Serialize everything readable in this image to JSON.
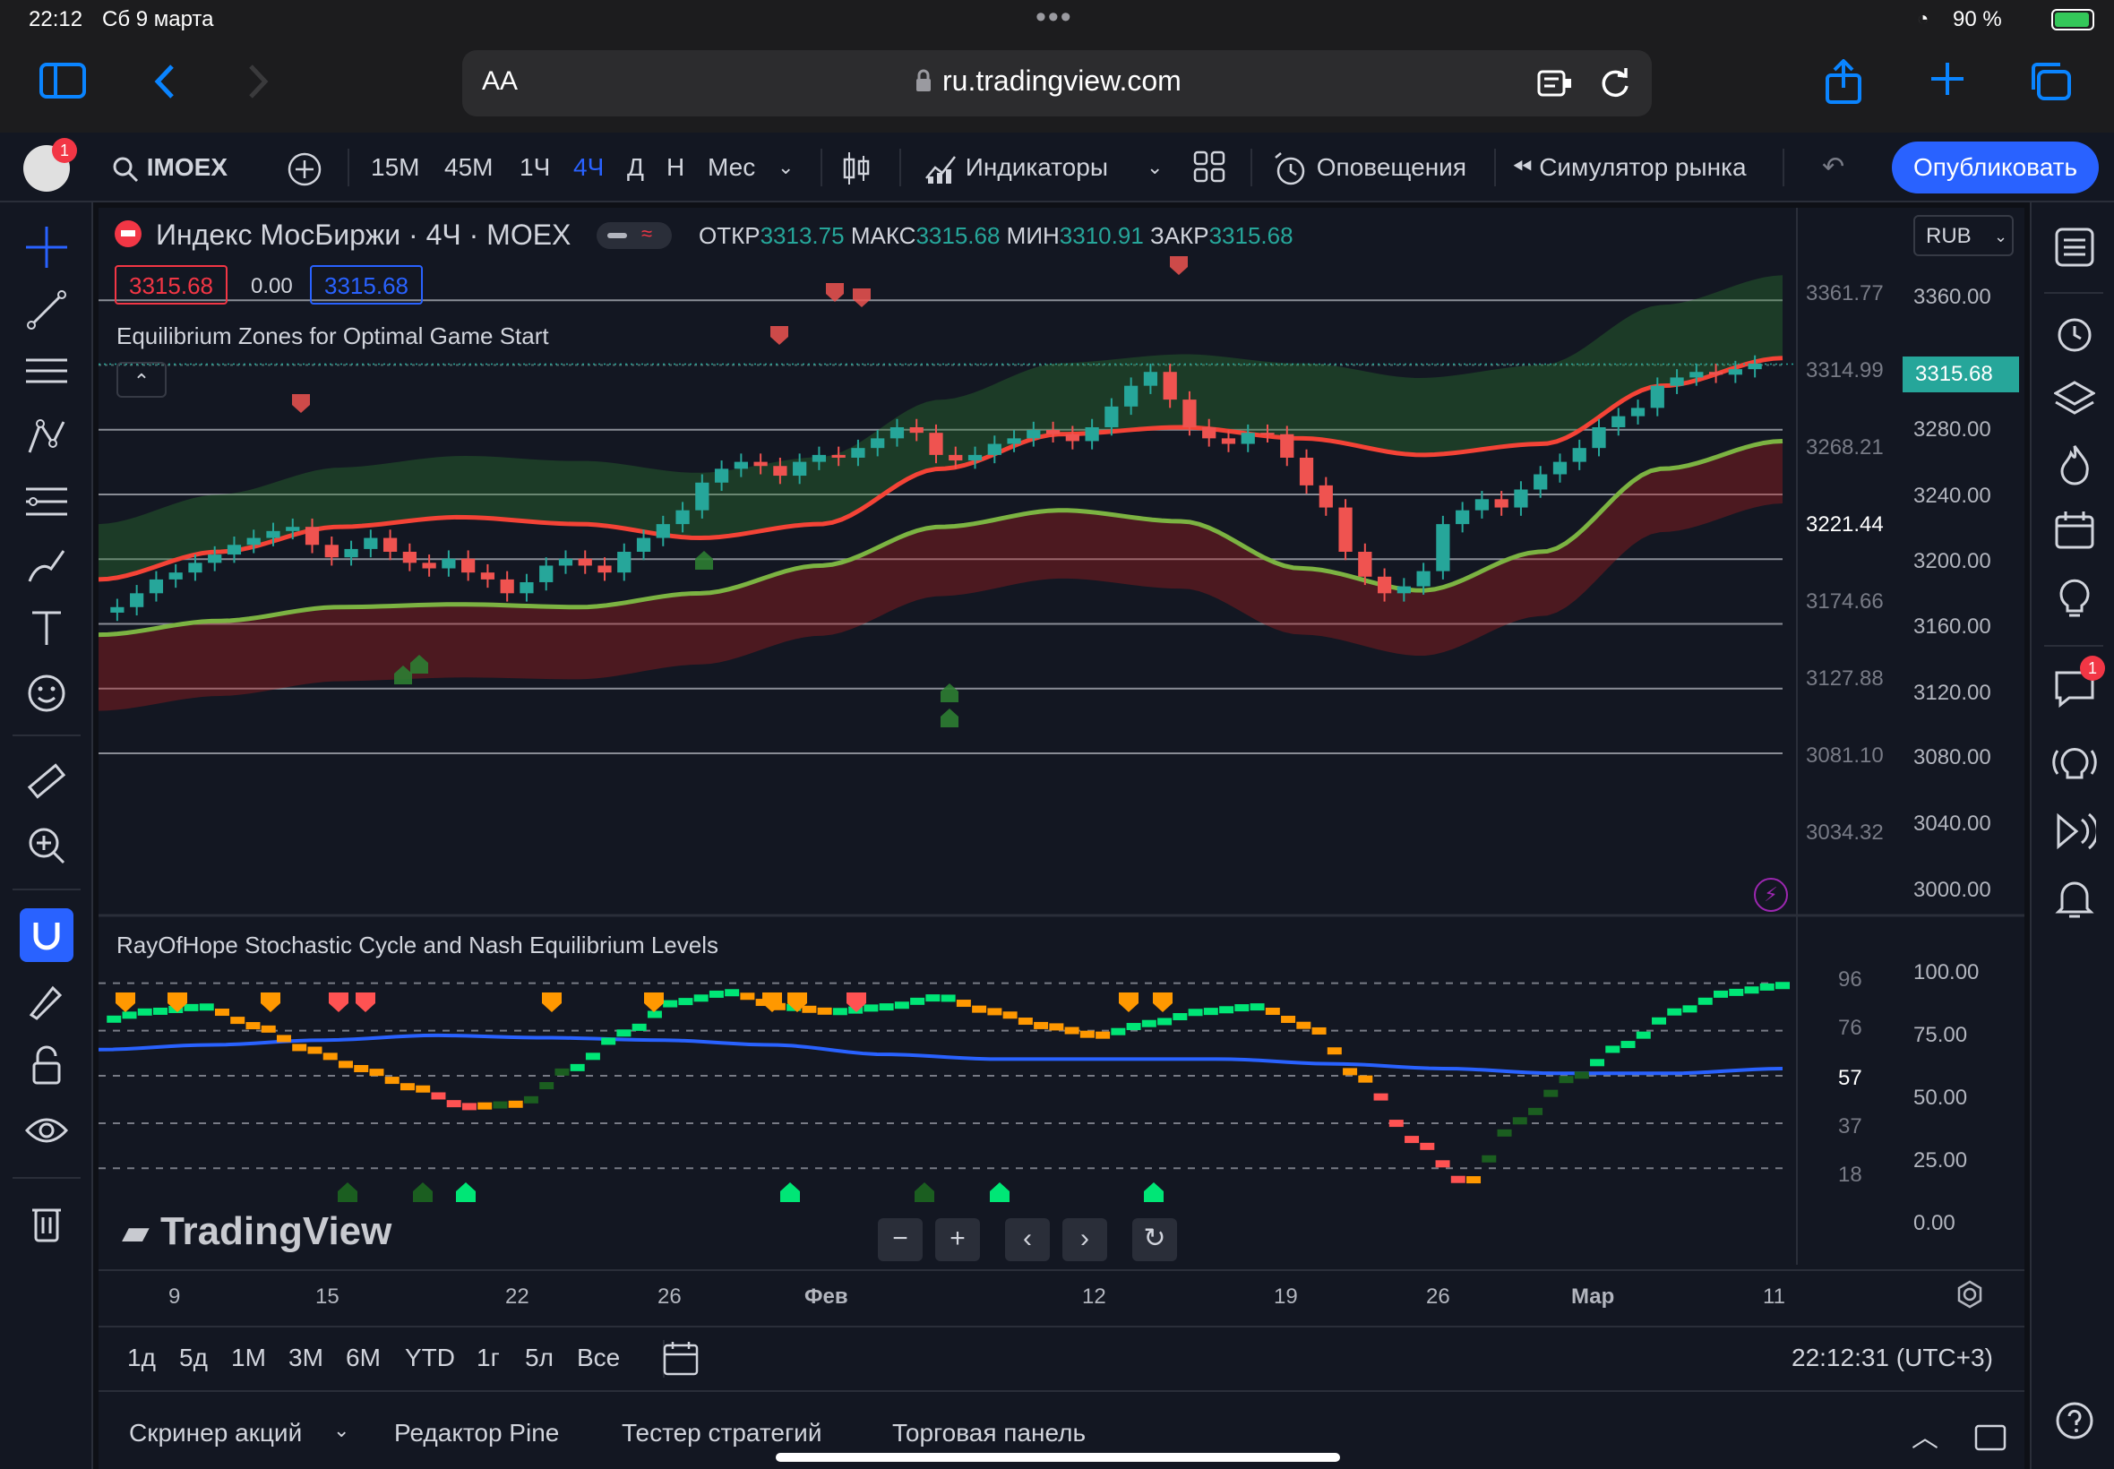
{
  "status": {
    "time": "22:12",
    "date": "Сб 9 марта",
    "battery": "90 %",
    "dots": "•••"
  },
  "browser": {
    "text_size": "AA",
    "url": "ru.tradingview.com"
  },
  "toolbar": {
    "avatar_badge": "1",
    "symbol": "IMOEX",
    "intervals": [
      "15М",
      "45М",
      "1Ч",
      "4Ч",
      "Д",
      "Н",
      "Мес"
    ],
    "active_interval": "4Ч",
    "indicators": "Индикаторы",
    "alerts": "Оповещения",
    "replay": "Симулятор рынка",
    "publish": "Опубликовать"
  },
  "legend": {
    "title": "Индекс МосБиржи · 4Ч · MOEX",
    "open_label": "ОТКР",
    "open": "3313.75",
    "high_label": "МАКС",
    "high": "3315.68",
    "low_label": "МИН",
    "low": "3310.91",
    "close_label": "ЗАКР",
    "close": "3315.68",
    "bid": "3315.68",
    "spread": "0.00",
    "ask": "3315.68",
    "currency": "RUB",
    "indicator1": "Equilibrium Zones for Optimal Game Start",
    "indicator2": "RayOfHope Stochastic Cycle and Nash Equilibrium Levels"
  },
  "price_axis": {
    "labels": [
      "3360.00",
      "3280.00",
      "3240.00",
      "3200.00",
      "3160.00",
      "3120.00",
      "3080.00",
      "3040.00",
      "3000.00"
    ],
    "current": "3315.68"
  },
  "levels": [
    "3361.77",
    "3314.99",
    "3268.21",
    "3221.44",
    "3174.66",
    "3127.88",
    "3081.10",
    "3034.32"
  ],
  "osc_axis": {
    "labels": [
      "100.00",
      "75.00",
      "50.00",
      "25.00",
      "0.00"
    ],
    "levels": [
      "96",
      "76",
      "57",
      "37",
      "18"
    ]
  },
  "time_axis": [
    "9",
    "15",
    "22",
    "26",
    "Фев",
    "12",
    "19",
    "26",
    "Мар",
    "11"
  ],
  "logo": "TradingView",
  "ranges": [
    "1д",
    "5д",
    "1М",
    "3М",
    "6М",
    "YTD",
    "1г",
    "5л",
    "Все"
  ],
  "clock": "22:12:31 (UTC+3)",
  "bottom_tabs": [
    "Скринер акций",
    "Редактор Pine",
    "Тестер стратегий",
    "Торговая панель"
  ],
  "right_badge": "1",
  "colors": {
    "bg": "#131722",
    "up": "#26a69a",
    "down": "#ef5350",
    "accent": "#2962ff",
    "osc_green": "#00e676",
    "osc_orange": "#ff9800",
    "osc_red": "#ff5252",
    "blue_line": "#2962ff"
  },
  "chart_data": {
    "type": "candlestick",
    "price_ylim": [
      3000,
      3380
    ],
    "osc_ylim": [
      0,
      100
    ],
    "indicator_levels": [
      3361.77,
      3314.99,
      3268.21,
      3221.44,
      3174.66,
      3127.88,
      3081.1,
      3034.32
    ],
    "close": [
      3140,
      3150,
      3160,
      3165,
      3172,
      3178,
      3185,
      3190,
      3195,
      3198,
      3185,
      3176,
      3182,
      3190,
      3180,
      3172,
      3168,
      3175,
      3165,
      3160,
      3150,
      3158,
      3170,
      3175,
      3170,
      3165,
      3180,
      3190,
      3200,
      3210,
      3230,
      3240,
      3245,
      3242,
      3235,
      3245,
      3250,
      3248,
      3255,
      3262,
      3270,
      3266,
      3250,
      3246,
      3250,
      3258,
      3262,
      3268,
      3265,
      3260,
      3270,
      3285,
      3300,
      3310,
      3290,
      3270,
      3262,
      3258,
      3266,
      3265,
      3248,
      3228,
      3212,
      3180,
      3162,
      3150,
      3155,
      3166,
      3200,
      3210,
      3218,
      3212,
      3225,
      3236,
      3245,
      3255,
      3270,
      3278,
      3284,
      3300,
      3306,
      3310,
      3308,
      3312,
      3316
    ],
    "red_band": [
      3160,
      3180,
      3198,
      3205,
      3200,
      3190,
      3200,
      3240,
      3265,
      3270,
      3262,
      3250,
      3258,
      3300,
      3320
    ],
    "green_band": [
      3120,
      3130,
      3140,
      3142,
      3140,
      3150,
      3170,
      3198,
      3210,
      3202,
      3168,
      3152,
      3180,
      3240,
      3260
    ],
    "oscillator": [
      80,
      84,
      86,
      78,
      68,
      60,
      52,
      44,
      45,
      60,
      75,
      88,
      92,
      86,
      84,
      86,
      90,
      84,
      78,
      74,
      79,
      84,
      86,
      78,
      56,
      30,
      12,
      38,
      56,
      70,
      84,
      92,
      95
    ],
    "blue_line": [
      68,
      70,
      72,
      74,
      73,
      72,
      70,
      66,
      64,
      64,
      64,
      62,
      60,
      58,
      58,
      60
    ]
  }
}
